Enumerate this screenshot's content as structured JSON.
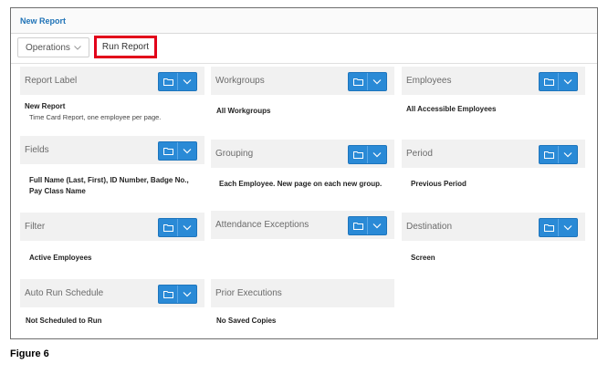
{
  "window": {
    "title": "New Report"
  },
  "toolbar": {
    "operations_label": "Operations",
    "run_report_label": "Run Report"
  },
  "panels": {
    "report_label": {
      "label": "Report Label",
      "value": "New Report",
      "sub": "Time Card Report, one employee per page."
    },
    "workgroups": {
      "label": "Workgroups",
      "value": "All Workgroups"
    },
    "employees": {
      "label": "Employees",
      "value": "All Accessible Employees"
    },
    "fields": {
      "label": "Fields",
      "value_line1": "Full Name (Last, First), ID Number, Badge No.,",
      "value_line2": "Pay Class Name"
    },
    "grouping": {
      "label": "Grouping",
      "value": "Each Employee. New page on each new group."
    },
    "period": {
      "label": "Period",
      "value": "Previous Period"
    },
    "filter": {
      "label": "Filter",
      "value": "Active Employees"
    },
    "attendance_exceptions": {
      "label": "Attendance Exceptions"
    },
    "destination": {
      "label": "Destination",
      "value": "Screen"
    },
    "auto_run_schedule": {
      "label": "Auto Run Schedule",
      "value": "Not Scheduled to Run"
    },
    "prior_executions": {
      "label": "Prior Executions",
      "value": "No Saved Copies"
    }
  },
  "caption": "Figure 6",
  "colors": {
    "accent_blue": "#2a8ad6",
    "title_blue": "#1f73b7",
    "highlight_red": "#e2001a"
  },
  "icons": {
    "folder": "folder-icon",
    "dropdown": "chevron-down-icon"
  }
}
